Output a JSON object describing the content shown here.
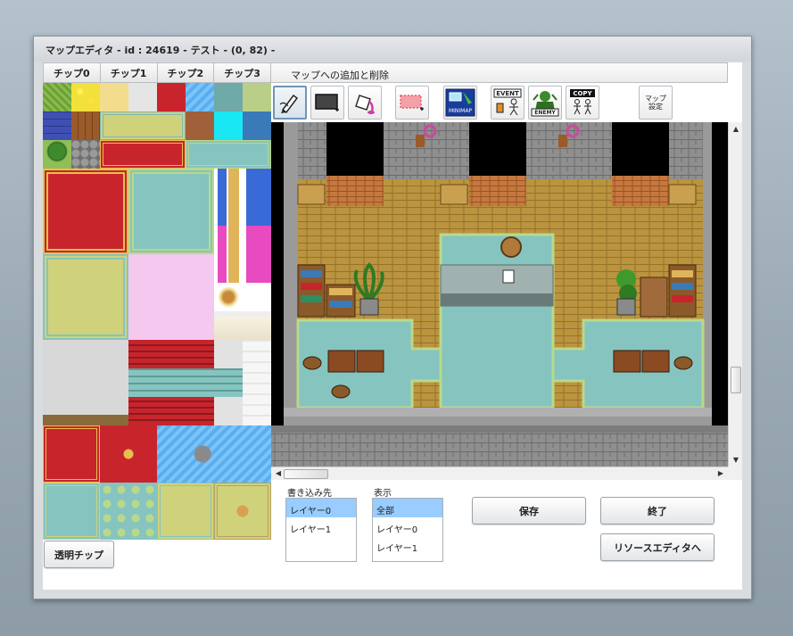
{
  "window": {
    "title": "マップエディタ - id : 24619 - テスト - (0, 82) -"
  },
  "chip_tabs": [
    {
      "label": "チップ0"
    },
    {
      "label": "チップ1"
    },
    {
      "label": "チップ2"
    },
    {
      "label": "チップ3"
    }
  ],
  "map_section": {
    "label": "マップへの追加と削除"
  },
  "tools": {
    "pen": "pen-tool",
    "rect": "rectangle-tool",
    "fill": "fill-bucket-tool",
    "selection": "selection-tool",
    "minimap_label": "MINIMAP",
    "event_label": "EVENT",
    "enemy_label": "ENEMY",
    "copy_label": "COPY",
    "map_settings_line1": "マップ",
    "map_settings_line2": "設定"
  },
  "write_target": {
    "label": "書き込み先",
    "options": [
      "レイヤー0",
      "レイヤー1"
    ],
    "selected": "レイヤー0"
  },
  "display": {
    "label": "表示",
    "options": [
      "全部",
      "レイヤー0",
      "レイヤー1"
    ],
    "selected": "全部"
  },
  "buttons": {
    "transparent_chip": "透明チップ",
    "save": "保存",
    "exit": "終了",
    "resource_editor": "リソースエディタへ"
  },
  "colors": {
    "accent_selected": "#99ccff",
    "floor_wood": "#b9923e",
    "stone_wall": "#8f8f8f",
    "carpet_teal": "#86c4c0",
    "curtain_red": "#c8242c",
    "curtain_green": "#2e8f62",
    "curtain_blue": "#2446b4"
  }
}
